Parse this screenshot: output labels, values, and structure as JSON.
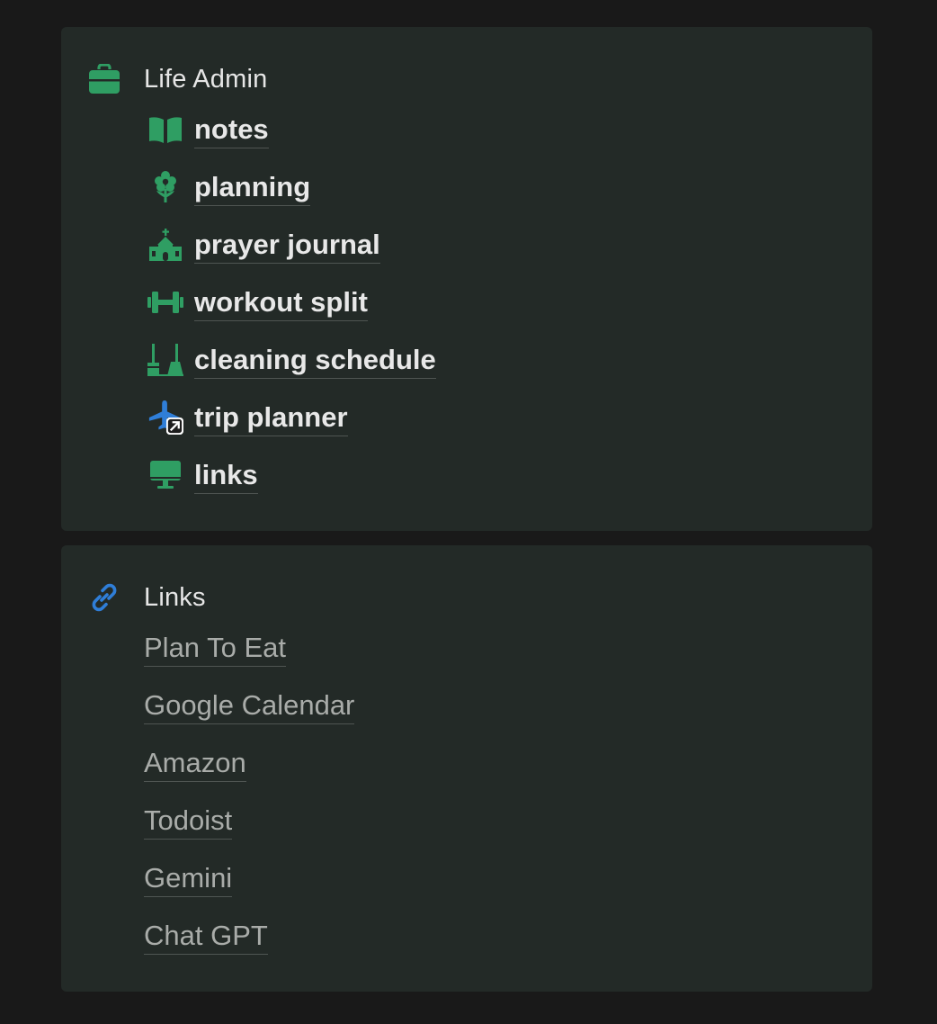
{
  "colors": {
    "background": "#191919",
    "card": "#232a27",
    "icon_green": "#2f9e63",
    "icon_blue": "#2f7ed8",
    "text_primary": "#e8e8e8",
    "text_link": "#a9aca9"
  },
  "life_admin": {
    "title": "Life Admin",
    "icon": "briefcase-icon",
    "items": [
      {
        "label": "notes",
        "icon": "open-book-icon"
      },
      {
        "label": "planning",
        "icon": "flower-icon"
      },
      {
        "label": "prayer journal",
        "icon": "church-icon"
      },
      {
        "label": "workout split",
        "icon": "dumbbell-icon"
      },
      {
        "label": "cleaning schedule",
        "icon": "broom-icon"
      },
      {
        "label": "trip planner",
        "icon": "airplane-shortcut-icon"
      },
      {
        "label": "links",
        "icon": "desktop-icon"
      }
    ]
  },
  "links_section": {
    "title": "Links",
    "icon": "link-icon",
    "items": [
      {
        "label": "Plan To Eat"
      },
      {
        "label": "Google Calendar"
      },
      {
        "label": "Amazon"
      },
      {
        "label": "Todoist"
      },
      {
        "label": "Gemini"
      },
      {
        "label": "Chat GPT"
      }
    ]
  }
}
